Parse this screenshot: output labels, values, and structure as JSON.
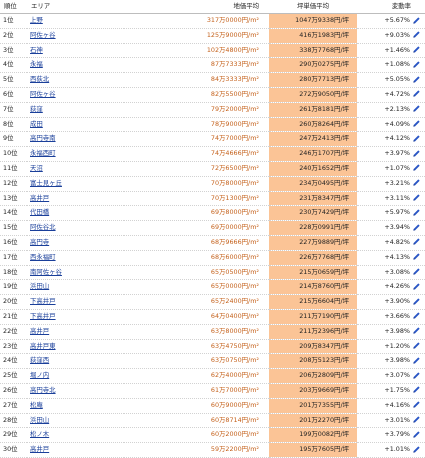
{
  "headers": {
    "rank": "順位",
    "area": "エリア",
    "avg_price": "地価平均",
    "tsubo_price": "坪単価平均",
    "change": "変動率"
  },
  "rows": [
    {
      "rank": "1位",
      "area": "上野",
      "price": "317万0000円/m²",
      "tsubo": "1047万9338円/坪",
      "change": "+5.67%"
    },
    {
      "rank": "2位",
      "area": "阿佐ヶ谷",
      "price": "125万9000円/m²",
      "tsubo": "416万1983円/坪",
      "change": "+9.03%"
    },
    {
      "rank": "3位",
      "area": "石神",
      "price": "102万4800円/m²",
      "tsubo": "338万7768円/坪",
      "change": "+1.46%"
    },
    {
      "rank": "4位",
      "area": "永福",
      "price": "87万7333円/m²",
      "tsubo": "290万0275円/坪",
      "change": "+1.08%"
    },
    {
      "rank": "5位",
      "area": "西荻北",
      "price": "84万3333円/m²",
      "tsubo": "280万7713円/坪",
      "change": "+5.05%"
    },
    {
      "rank": "6位",
      "area": "阿佐ヶ谷",
      "price": "82万5500円/m²",
      "tsubo": "272万9050円/坪",
      "change": "+4.72%"
    },
    {
      "rank": "7位",
      "area": "荻窪",
      "price": "79万2000円/m²",
      "tsubo": "261万8181円/坪",
      "change": "+2.13%"
    },
    {
      "rank": "8位",
      "area": "成田",
      "price": "78万9000円/m²",
      "tsubo": "260万8264円/坪",
      "change": "+4.09%"
    },
    {
      "rank": "9位",
      "area": "高円寺南",
      "price": "74万7000円/m²",
      "tsubo": "247万2413円/坪",
      "change": "+4.12%"
    },
    {
      "rank": "10位",
      "area": "永福西町",
      "price": "74万4666円/m²",
      "tsubo": "246万1707円/坪",
      "change": "+3.97%"
    },
    {
      "rank": "11位",
      "area": "天沼",
      "price": "72万6500円/m²",
      "tsubo": "240万1652円/坪",
      "change": "+1.07%"
    },
    {
      "rank": "12位",
      "area": "富士見ヶ丘",
      "price": "70万8000円/m²",
      "tsubo": "234万0495円/坪",
      "change": "+3.21%"
    },
    {
      "rank": "13位",
      "area": "高井戸",
      "price": "70万1300円/m²",
      "tsubo": "231万8347円/坪",
      "change": "+3.11%"
    },
    {
      "rank": "14位",
      "area": "代田橋",
      "price": "69万8000円/m²",
      "tsubo": "230万7429円/坪",
      "change": "+5.97%"
    },
    {
      "rank": "15位",
      "area": "阿佐谷北",
      "price": "69万0000円/m²",
      "tsubo": "228万0991円/坪",
      "change": "+3.94%"
    },
    {
      "rank": "16位",
      "area": "高円寺",
      "price": "68万9666円/m²",
      "tsubo": "227万9889円/坪",
      "change": "+4.82%"
    },
    {
      "rank": "17位",
      "area": "西永福町",
      "price": "68万6000円/m²",
      "tsubo": "226万7768円/坪",
      "change": "+4.13%"
    },
    {
      "rank": "18位",
      "area": "南阿佐ヶ谷",
      "price": "65万0500円/m²",
      "tsubo": "215万0659円/坪",
      "change": "+3.08%"
    },
    {
      "rank": "19位",
      "area": "浜田山",
      "price": "65万0000円/m²",
      "tsubo": "214万8760円/坪",
      "change": "+4.26%"
    },
    {
      "rank": "20位",
      "area": "下高井戸",
      "price": "65万2400円/m²",
      "tsubo": "215万6604円/坪",
      "change": "+3.90%"
    },
    {
      "rank": "21位",
      "area": "下高井戸",
      "price": "64万0400円/m²",
      "tsubo": "211万7190円/坪",
      "change": "+3.66%"
    },
    {
      "rank": "22位",
      "area": "高井戸",
      "price": "63万8000円/m²",
      "tsubo": "211万2396円/坪",
      "change": "+3.98%"
    },
    {
      "rank": "23位",
      "area": "高井戸東",
      "price": "63万4750円/m²",
      "tsubo": "209万8347円/坪",
      "change": "+1.20%"
    },
    {
      "rank": "24位",
      "area": "荻窪西",
      "price": "63万0750円/m²",
      "tsubo": "208万5123円/坪",
      "change": "+3.98%"
    },
    {
      "rank": "25位",
      "area": "堀ノ内",
      "price": "62万4000円/m²",
      "tsubo": "206万2809円/坪",
      "change": "+3.07%"
    },
    {
      "rank": "26位",
      "area": "高円寺北",
      "price": "61万7000円/m²",
      "tsubo": "203万9669円/坪",
      "change": "+1.75%"
    },
    {
      "rank": "27位",
      "area": "松庵",
      "price": "60万9000円/m²",
      "tsubo": "201万7355円/坪",
      "change": "+4.16%"
    },
    {
      "rank": "28位",
      "area": "浜田山",
      "price": "60万8714円/m²",
      "tsubo": "201万2270円/坪",
      "change": "+3.01%"
    },
    {
      "rank": "29位",
      "area": "松ノ木",
      "price": "60万2000円/m²",
      "tsubo": "199万0082円/坪",
      "change": "+3.79%"
    },
    {
      "rank": "30位",
      "area": "高井戸",
      "price": "59万2200円/m²",
      "tsubo": "195万7605円/坪",
      "change": "+1.01%"
    }
  ],
  "icons": {
    "trend": "pencil-trend-icon"
  },
  "colors": {
    "accent_orange": "#fbc496",
    "price_text": "#c4601a",
    "link_blue": "#1a3f9a",
    "icon_blue": "#2a56c6"
  }
}
